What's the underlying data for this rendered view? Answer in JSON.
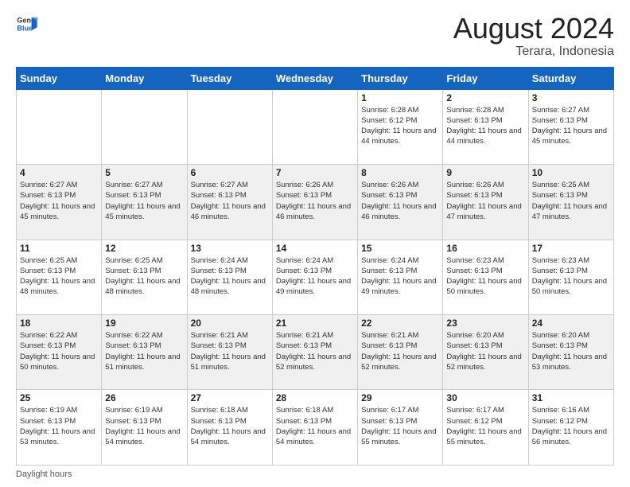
{
  "header": {
    "logo_general": "General",
    "logo_blue": "Blue",
    "month_title": "August 2024",
    "location": "Terara, Indonesia"
  },
  "weekdays": [
    "Sunday",
    "Monday",
    "Tuesday",
    "Wednesday",
    "Thursday",
    "Friday",
    "Saturday"
  ],
  "footer": {
    "daylight_label": "Daylight hours"
  },
  "weeks": [
    [
      {
        "day": "",
        "info": ""
      },
      {
        "day": "",
        "info": ""
      },
      {
        "day": "",
        "info": ""
      },
      {
        "day": "",
        "info": ""
      },
      {
        "day": "1",
        "info": "Sunrise: 6:28 AM\nSunset: 6:12 PM\nDaylight: 11 hours\nand 44 minutes."
      },
      {
        "day": "2",
        "info": "Sunrise: 6:28 AM\nSunset: 6:13 PM\nDaylight: 11 hours\nand 44 minutes."
      },
      {
        "day": "3",
        "info": "Sunrise: 6:27 AM\nSunset: 6:13 PM\nDaylight: 11 hours\nand 45 minutes."
      }
    ],
    [
      {
        "day": "4",
        "info": "Sunrise: 6:27 AM\nSunset: 6:13 PM\nDaylight: 11 hours\nand 45 minutes."
      },
      {
        "day": "5",
        "info": "Sunrise: 6:27 AM\nSunset: 6:13 PM\nDaylight: 11 hours\nand 45 minutes."
      },
      {
        "day": "6",
        "info": "Sunrise: 6:27 AM\nSunset: 6:13 PM\nDaylight: 11 hours\nand 46 minutes."
      },
      {
        "day": "7",
        "info": "Sunrise: 6:26 AM\nSunset: 6:13 PM\nDaylight: 11 hours\nand 46 minutes."
      },
      {
        "day": "8",
        "info": "Sunrise: 6:26 AM\nSunset: 6:13 PM\nDaylight: 11 hours\nand 46 minutes."
      },
      {
        "day": "9",
        "info": "Sunrise: 6:26 AM\nSunset: 6:13 PM\nDaylight: 11 hours\nand 47 minutes."
      },
      {
        "day": "10",
        "info": "Sunrise: 6:25 AM\nSunset: 6:13 PM\nDaylight: 11 hours\nand 47 minutes."
      }
    ],
    [
      {
        "day": "11",
        "info": "Sunrise: 6:25 AM\nSunset: 6:13 PM\nDaylight: 11 hours\nand 48 minutes."
      },
      {
        "day": "12",
        "info": "Sunrise: 6:25 AM\nSunset: 6:13 PM\nDaylight: 11 hours\nand 48 minutes."
      },
      {
        "day": "13",
        "info": "Sunrise: 6:24 AM\nSunset: 6:13 PM\nDaylight: 11 hours\nand 48 minutes."
      },
      {
        "day": "14",
        "info": "Sunrise: 6:24 AM\nSunset: 6:13 PM\nDaylight: 11 hours\nand 49 minutes."
      },
      {
        "day": "15",
        "info": "Sunrise: 6:24 AM\nSunset: 6:13 PM\nDaylight: 11 hours\nand 49 minutes."
      },
      {
        "day": "16",
        "info": "Sunrise: 6:23 AM\nSunset: 6:13 PM\nDaylight: 11 hours\nand 50 minutes."
      },
      {
        "day": "17",
        "info": "Sunrise: 6:23 AM\nSunset: 6:13 PM\nDaylight: 11 hours\nand 50 minutes."
      }
    ],
    [
      {
        "day": "18",
        "info": "Sunrise: 6:22 AM\nSunset: 6:13 PM\nDaylight: 11 hours\nand 50 minutes."
      },
      {
        "day": "19",
        "info": "Sunrise: 6:22 AM\nSunset: 6:13 PM\nDaylight: 11 hours\nand 51 minutes."
      },
      {
        "day": "20",
        "info": "Sunrise: 6:21 AM\nSunset: 6:13 PM\nDaylight: 11 hours\nand 51 minutes."
      },
      {
        "day": "21",
        "info": "Sunrise: 6:21 AM\nSunset: 6:13 PM\nDaylight: 11 hours\nand 52 minutes."
      },
      {
        "day": "22",
        "info": "Sunrise: 6:21 AM\nSunset: 6:13 PM\nDaylight: 11 hours\nand 52 minutes."
      },
      {
        "day": "23",
        "info": "Sunrise: 6:20 AM\nSunset: 6:13 PM\nDaylight: 11 hours\nand 52 minutes."
      },
      {
        "day": "24",
        "info": "Sunrise: 6:20 AM\nSunset: 6:13 PM\nDaylight: 11 hours\nand 53 minutes."
      }
    ],
    [
      {
        "day": "25",
        "info": "Sunrise: 6:19 AM\nSunset: 6:13 PM\nDaylight: 11 hours\nand 53 minutes."
      },
      {
        "day": "26",
        "info": "Sunrise: 6:19 AM\nSunset: 6:13 PM\nDaylight: 11 hours\nand 54 minutes."
      },
      {
        "day": "27",
        "info": "Sunrise: 6:18 AM\nSunset: 6:13 PM\nDaylight: 11 hours\nand 54 minutes."
      },
      {
        "day": "28",
        "info": "Sunrise: 6:18 AM\nSunset: 6:13 PM\nDaylight: 11 hours\nand 54 minutes."
      },
      {
        "day": "29",
        "info": "Sunrise: 6:17 AM\nSunset: 6:13 PM\nDaylight: 11 hours\nand 55 minutes."
      },
      {
        "day": "30",
        "info": "Sunrise: 6:17 AM\nSunset: 6:12 PM\nDaylight: 11 hours\nand 55 minutes."
      },
      {
        "day": "31",
        "info": "Sunrise: 6:16 AM\nSunset: 6:12 PM\nDaylight: 11 hours\nand 56 minutes."
      }
    ]
  ]
}
